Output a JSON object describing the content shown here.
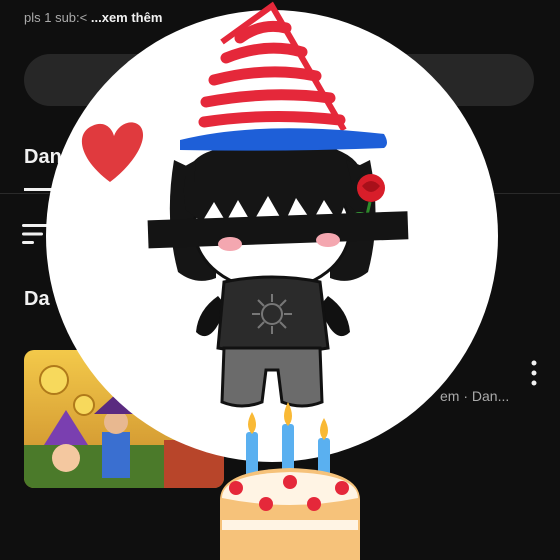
{
  "channel": {
    "description_text": "pls 1 sub:<",
    "more_link": "...xem thêm"
  },
  "tabs": [
    {
      "label": "Dan"
    }
  ],
  "section": {
    "title": "Da"
  },
  "video": {
    "meta": "em · Dan..."
  },
  "colors": {
    "background": "#0f0f0f",
    "surface": "#272727",
    "text_primary": "#f1f1f1",
    "text_secondary": "#aaaaaa",
    "heart": "#e03a3e",
    "hat_red": "#e5283a",
    "hat_blue": "#1e5fd8"
  },
  "icons": [
    "sort-icon",
    "more-vert-icon",
    "heart-emoji-icon",
    "rose-emoji-icon",
    "birthday-cake-emoji-icon"
  ]
}
